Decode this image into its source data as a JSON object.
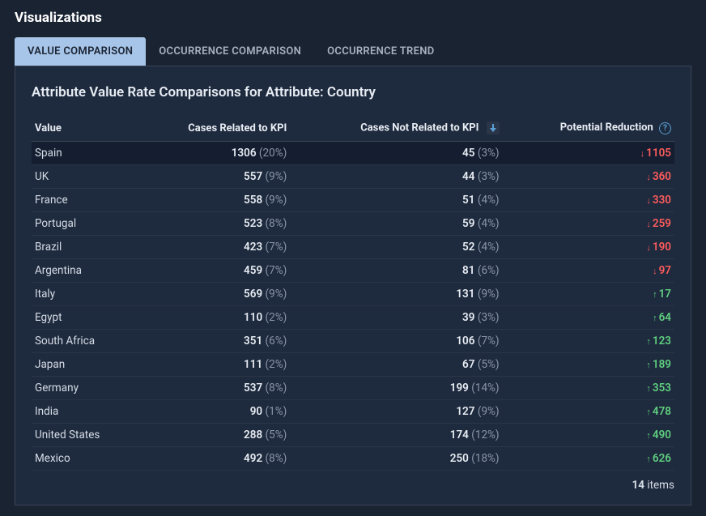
{
  "section_title": "Visualizations",
  "tabs": [
    {
      "label": "VALUE COMPARISON",
      "active": true
    },
    {
      "label": "OCCURRENCE COMPARISON",
      "active": false
    },
    {
      "label": "OCCURRENCE TREND",
      "active": false
    }
  ],
  "panel": {
    "title": "Attribute Value Rate Comparisons for Attribute: Country",
    "columns": {
      "value": "Value",
      "related": "Cases Related to KPI",
      "not_related": "Cases Not Related to KPI",
      "reduction": "Potential Reduction"
    },
    "rows": [
      {
        "value": "Spain",
        "related_n": "1306",
        "related_pct": "(20%)",
        "not_n": "45",
        "not_pct": "(3%)",
        "red_dir": "down",
        "red_v": "1105",
        "highlight": true
      },
      {
        "value": "UK",
        "related_n": "557",
        "related_pct": "(9%)",
        "not_n": "44",
        "not_pct": "(3%)",
        "red_dir": "down",
        "red_v": "360"
      },
      {
        "value": "France",
        "related_n": "558",
        "related_pct": "(9%)",
        "not_n": "51",
        "not_pct": "(4%)",
        "red_dir": "down",
        "red_v": "330"
      },
      {
        "value": "Portugal",
        "related_n": "523",
        "related_pct": "(8%)",
        "not_n": "59",
        "not_pct": "(4%)",
        "red_dir": "down",
        "red_v": "259"
      },
      {
        "value": "Brazil",
        "related_n": "423",
        "related_pct": "(7%)",
        "not_n": "52",
        "not_pct": "(4%)",
        "red_dir": "down",
        "red_v": "190"
      },
      {
        "value": "Argentina",
        "related_n": "459",
        "related_pct": "(7%)",
        "not_n": "81",
        "not_pct": "(6%)",
        "red_dir": "down",
        "red_v": "97"
      },
      {
        "value": "Italy",
        "related_n": "569",
        "related_pct": "(9%)",
        "not_n": "131",
        "not_pct": "(9%)",
        "red_dir": "up",
        "red_v": "17"
      },
      {
        "value": "Egypt",
        "related_n": "110",
        "related_pct": "(2%)",
        "not_n": "39",
        "not_pct": "(3%)",
        "red_dir": "up",
        "red_v": "64"
      },
      {
        "value": "South Africa",
        "related_n": "351",
        "related_pct": "(6%)",
        "not_n": "106",
        "not_pct": "(7%)",
        "red_dir": "up",
        "red_v": "123"
      },
      {
        "value": "Japan",
        "related_n": "111",
        "related_pct": "(2%)",
        "not_n": "67",
        "not_pct": "(5%)",
        "red_dir": "up",
        "red_v": "189"
      },
      {
        "value": "Germany",
        "related_n": "537",
        "related_pct": "(8%)",
        "not_n": "199",
        "not_pct": "(14%)",
        "red_dir": "up",
        "red_v": "353"
      },
      {
        "value": "India",
        "related_n": "90",
        "related_pct": "(1%)",
        "not_n": "127",
        "not_pct": "(9%)",
        "red_dir": "up",
        "red_v": "478"
      },
      {
        "value": "United States",
        "related_n": "288",
        "related_pct": "(5%)",
        "not_n": "174",
        "not_pct": "(12%)",
        "red_dir": "up",
        "red_v": "490"
      },
      {
        "value": "Mexico",
        "related_n": "492",
        "related_pct": "(8%)",
        "not_n": "250",
        "not_pct": "(18%)",
        "red_dir": "up",
        "red_v": "626"
      }
    ],
    "footer_count": "14",
    "footer_label": "items"
  }
}
